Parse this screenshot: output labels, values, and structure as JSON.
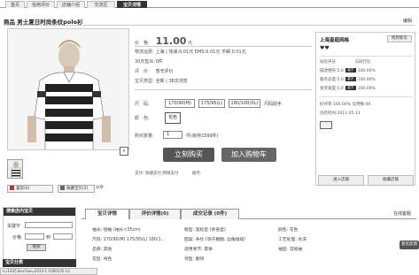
{
  "nav": {
    "tabs": [
      "首页",
      "信用评价",
      "店铺介绍",
      "交流区",
      "宝贝详情"
    ],
    "active_index": 4
  },
  "product": {
    "title": "商品 男士夏日时尚条纹polo衫",
    "edit_label": "编辑",
    "price_label": "价　格:",
    "price_value": "11.00",
    "price_unit": "元",
    "shipping_label": "物流运费:",
    "shipping_value": "上海 | 快递:0.01元 EMS:0.01元 平邮:0.01元",
    "sales_label": "30天售出:",
    "sales_value": "0件",
    "rating_label": "评　价:",
    "rating_value": "暂无评价",
    "type_label": "宝贝类型:",
    "type_value": "全新 | 38次浏览",
    "size_label": "尺　码:",
    "sizes": [
      "170/90(M)",
      "175/95(L)",
      "180/100(XL)"
    ],
    "size_ref": "尺码助手",
    "color_label": "颜　色:",
    "color_value": "花色",
    "qty_label": "购买数量:",
    "qty_value": "1",
    "qty_stock": "件(库存2399件)",
    "buy_label": "立刻购买",
    "cart_label": "加入购物车",
    "pay_text": "支付: 快捷支付  网银支付",
    "service_text": "服务:",
    "zoom_icon": "magnifier-icon",
    "fav_label": "喜欢",
    "fav_count": "(0)",
    "collect_label": "收藏宝贝",
    "collect_count": "(2)",
    "share_label": "分享"
  },
  "shop": {
    "name": "上海皇庭网格",
    "badge": "找到新东",
    "hearts": "♥♥",
    "col1_header": "动态评分",
    "col2_header": "与同行比",
    "rows": [
      {
        "label": "描述相符:",
        "score": "5.0",
        "tag": "高于",
        "pct": "100.00%"
      },
      {
        "label": "服务态度:",
        "score": "5.0",
        "tag": "高于",
        "pct": "100.00%"
      },
      {
        "label": "发货速度:",
        "score": "5.0",
        "tag": "高于",
        "pct": "100.00%"
      }
    ],
    "goodrate": "好评率:100.00%  信用数:49",
    "since": "创店时间:2011-05-11",
    "enter_label": "进入店铺",
    "collect_shop_label": "收藏店铺"
  },
  "search_panel": {
    "title": "搜索店内宝贝",
    "keyword_label": "关键字",
    "price_label": "价格",
    "to_label": "到",
    "search_btn": "搜索",
    "category_title": "宝贝分类",
    "status_url": "s=1035 &ns?uw=2013-1-1000135-12"
  },
  "detail_tabs": {
    "tabs": [
      "宝贝详情",
      "评价详情(0)",
      "成交记录 (0件)"
    ],
    "mobile_label": "在线客服"
  },
  "attributes": [
    {
      "text": "袖长: 短袖 (袖长<35cm)"
    },
    {
      "text": "版型: 宽松型 (修身型)"
    },
    {
      "text": "颜色: 花色"
    },
    {
      "text": "尺码: 170/90(M) 175/95(L) 180/1..."
    },
    {
      "text": "图案: 条纹 (领子翻翻, 边角缀缝)"
    },
    {
      "text": "工艺处理: 水洗"
    },
    {
      "text": "品牌: 其他"
    },
    {
      "text": "适用季节: 夏季"
    },
    {
      "text": "袖型: 常规袖"
    },
    {
      "text": "花型: 纯色"
    },
    {
      "text": "领型: 翻领"
    }
  ],
  "feedback_label": "意见反馈"
}
